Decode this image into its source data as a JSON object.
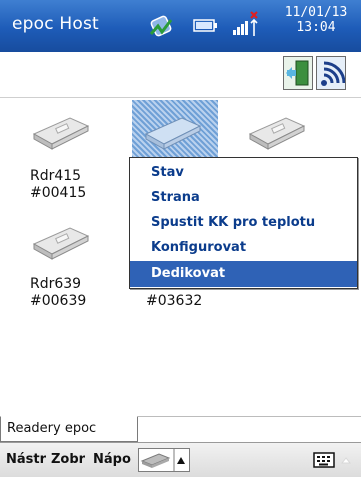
{
  "titlebar": {
    "title": "epoc Host",
    "clock_date": "11/01/13",
    "clock_time": "13:04"
  },
  "readers": [
    {
      "name": "Rdr415",
      "id": "#00415"
    },
    {
      "name": "Rdr639",
      "id": "#00639"
    },
    {
      "name": "",
      "id": "#03632"
    }
  ],
  "context_menu": {
    "items": [
      "Stav",
      "Strana",
      "Spustit KK pro teplotu",
      "Konfigurovat",
      "Dedikovat"
    ],
    "selected": "Dedikovat"
  },
  "tab": {
    "label": "Readery epoc"
  },
  "menubar": {
    "items": [
      "Nástr",
      "Zobr",
      "Nápo"
    ]
  },
  "icons": {
    "sync": "sync-icon",
    "battery": "battery-icon",
    "signal": "signal-icon",
    "exit": "exit-door-icon",
    "wireless": "wireless-icon",
    "reader": "reader-device-icon",
    "keyboard": "keyboard-icon"
  },
  "colors": {
    "titlebar": "#1e5cb8",
    "menu_text": "#0b3c8c",
    "menu_selected": "#2f62b6"
  }
}
